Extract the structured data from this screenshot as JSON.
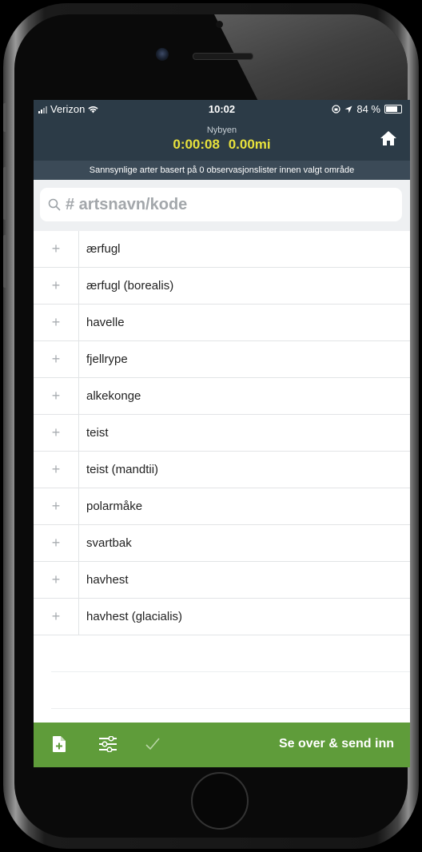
{
  "status_bar": {
    "carrier": "Verizon",
    "time": "10:02",
    "battery": "84 %"
  },
  "header": {
    "location": "Nybyen",
    "elapsed_time": "0:00:08",
    "distance": "0.00mi",
    "home_icon": "home-icon"
  },
  "info_bar": {
    "text": "Sannsynlige arter basert på 0 observasjonslister innen valgt område"
  },
  "search": {
    "placeholder": "# artsnavn/kode",
    "value": "",
    "icon": "search-icon"
  },
  "species_list": [
    {
      "add": "+",
      "name": "ærfugl"
    },
    {
      "add": "+",
      "name": "ærfugl (borealis)"
    },
    {
      "add": "+",
      "name": "havelle"
    },
    {
      "add": "+",
      "name": "fjellrype"
    },
    {
      "add": "+",
      "name": "alkekonge"
    },
    {
      "add": "+",
      "name": "teist"
    },
    {
      "add": "+",
      "name": "teist (mandtii)"
    },
    {
      "add": "+",
      "name": "polarmåke"
    },
    {
      "add": "+",
      "name": "svartbak"
    },
    {
      "add": "+",
      "name": "havhest"
    },
    {
      "add": "+",
      "name": "havhest (glacialis)"
    }
  ],
  "bottom_bar": {
    "icons": [
      "add-file-icon",
      "filter-sliders-icon",
      "checkmark-icon"
    ],
    "submit_label": "Se over & send inn"
  },
  "colors": {
    "header_bg": "#2c3b47",
    "timer": "#e8e23c",
    "bottom_bar_bg": "#5f9c3a"
  }
}
